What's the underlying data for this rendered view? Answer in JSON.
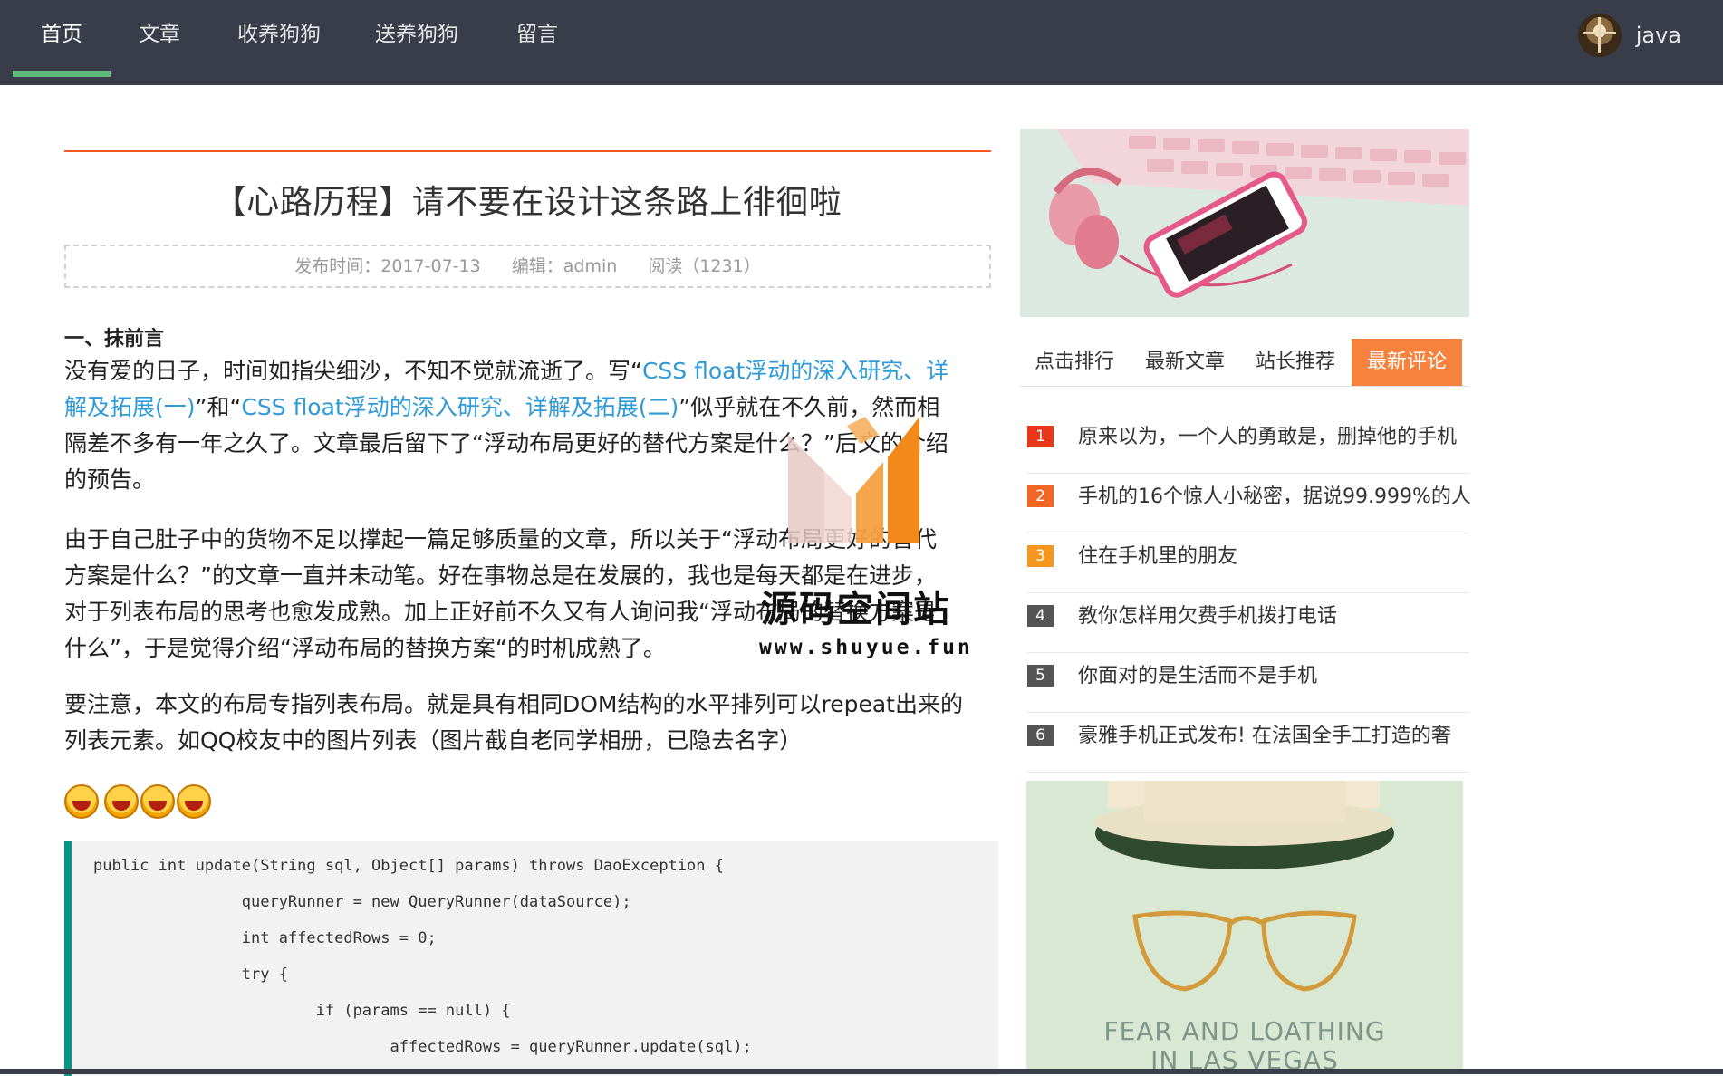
{
  "nav": {
    "items": [
      {
        "label": "首页",
        "active": true
      },
      {
        "label": "文章",
        "active": false
      },
      {
        "label": "收养狗狗",
        "active": false
      },
      {
        "label": "送养狗狗",
        "active": false
      },
      {
        "label": "留言",
        "active": false
      }
    ],
    "active_color": "#5fb878",
    "user": {
      "name": "java",
      "avatar_icon": "user-avatar"
    }
  },
  "article": {
    "title": "【心路历程】请不要在设计这条路上徘徊啦",
    "meta": {
      "publish": "发布时间：2017-07-13",
      "editor": "编辑：admin",
      "reads": "阅读（1231）"
    },
    "section_heading": "一、抹前言",
    "p1": {
      "line1_a": "没有爱的日子，时间如指尖细沙，不知不觉就流逝了。写“",
      "link1_a": "CSS float浮动的深入研究、详",
      "link1_b": "解及拓展(一)",
      "line2_a": "”和“",
      "link2": "CSS float浮动的深入研究、详解及拓展(二)",
      "line2_b": "”似乎就在不久前，然而相",
      "line3": "隔差不多有一年之久了。文章最后留下了“浮动布局更好的替代方案是什么？”后文的介绍",
      "line4": "的预告。"
    },
    "p2": [
      "由于自己肚子中的货物不足以撑起一篇足够质量的文章，所以关于“浮动布局更好的替代",
      "方案是什么？”的文章一直并未动笔。好在事物总是在发展的，我也是每天都是在进步，",
      "对于列表布局的思考也愈发成熟。加上正好前不久又有人询问我“浮动布局的替换方案是",
      "什么”，于是觉得介绍“浮动布局的替换方案“的时机成熟了。"
    ],
    "p3": [
      "要注意，本文的布局专指列表布局。就是具有相同DOM结构的水平排列可以repeat出来的",
      "列表元素。如QQ校友中的图片列表（图片截自老同学相册，已隐去名字）"
    ],
    "emoji_icon": "laughing-emoji-icon",
    "code": [
      "public int update(String sql, Object[] params) throws DaoException {",
      "                queryRunner = new QueryRunner(dataSource);",
      "                int affectedRows = 0;",
      "                try {",
      "                        if (params == null) {",
      "                                affectedRows = queryRunner.update(sql);"
    ],
    "accent_color": "#ff5722",
    "link_color": "#2f9ad8"
  },
  "watermark": {
    "cn": "源码空间站",
    "url": "www.shuyue.fun"
  },
  "sidebar": {
    "tabs": [
      {
        "label": "点击排行",
        "active": false
      },
      {
        "label": "最新文章",
        "active": false
      },
      {
        "label": "站长推荐",
        "active": false
      },
      {
        "label": "最新评论",
        "active": true
      }
    ],
    "tab_active_color": "#f6823d",
    "rank": [
      {
        "num": "1",
        "text": "原来以为，一个人的勇敢是，删掉他的手机",
        "color": "#e8371b"
      },
      {
        "num": "2",
        "text": "手机的16个惊人小秘密，据说99.999%的人",
        "color": "#f26524"
      },
      {
        "num": "3",
        "text": "住在手机里的朋友",
        "color": "#f5961f"
      },
      {
        "num": "4",
        "text": "教你怎样用欠费手机拨打电话",
        "color": "#555555"
      },
      {
        "num": "5",
        "text": "你面对的是生活而不是手机",
        "color": "#555555"
      },
      {
        "num": "6",
        "text": "豪雅手机正式发布! 在法国全手工打造的奢",
        "color": "#555555"
      }
    ],
    "poster": {
      "line1": "FEAR AND LOATHING",
      "line2": "IN LAS VEGAS"
    }
  }
}
